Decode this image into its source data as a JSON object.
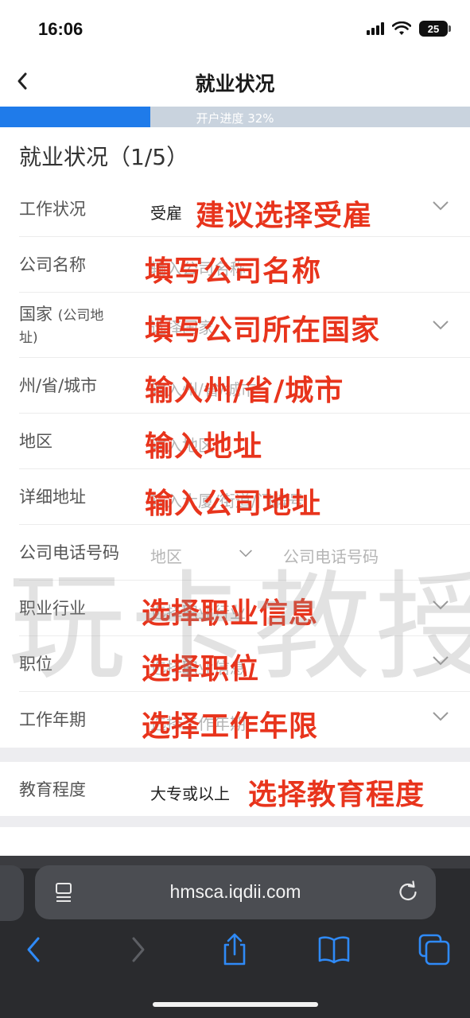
{
  "status_bar": {
    "time": "16:06",
    "battery": "25"
  },
  "header": {
    "title": "就业状况"
  },
  "progress": {
    "label": "开户进度 32%",
    "percent": 32
  },
  "section": {
    "title": "就业状况（1/5）"
  },
  "rows": {
    "work_status": {
      "label": "工作状况",
      "value": "受雇",
      "annotation": "建议选择受雇"
    },
    "company_name": {
      "label": "公司名称",
      "placeholder": "输入公司名称",
      "annotation": "填写公司名称"
    },
    "country": {
      "label": "国家",
      "label_sub": "(公司地",
      "label_line2": "址)",
      "placeholder": "选择国家",
      "annotation": "填写公司所在国家"
    },
    "state_city": {
      "label": "州/省/城市",
      "placeholder": "输入州/省/城市",
      "annotation": "输入州/省/城市"
    },
    "district": {
      "label": "地区",
      "placeholder": "输入地区",
      "annotation": "输入地址"
    },
    "address": {
      "label": "详细地址",
      "placeholder": "输入大厦/街道/门牌号",
      "annotation": "输入公司地址"
    },
    "phone": {
      "label": "公司电话号码",
      "area_placeholder": "地区",
      "phone_placeholder": "公司电话号码"
    },
    "industry": {
      "label": "职业行业",
      "placeholder": "选择职业行业",
      "annotation": "选择职业信息"
    },
    "position": {
      "label": "职位",
      "placeholder": "选择职业信息",
      "annotation": "选择职位"
    },
    "work_years": {
      "label": "工作年期",
      "placeholder": "选择工作年期",
      "annotation": "选择工作年限"
    },
    "education": {
      "label": "教育程度",
      "value": "大专或以上",
      "annotation": "选择教育程度"
    }
  },
  "watermark": "玩卡教授",
  "browser": {
    "url": "hmsca.iqdii.com"
  },
  "icons": [
    "back-chevron-icon",
    "chevron-down-icon",
    "reader-icon",
    "reload-icon",
    "share-icon",
    "bookmarks-icon",
    "tabs-icon"
  ],
  "colors": {
    "accent": "#1f7bea",
    "annotation": "#e8341c",
    "progress_track": "#c9d3de"
  }
}
